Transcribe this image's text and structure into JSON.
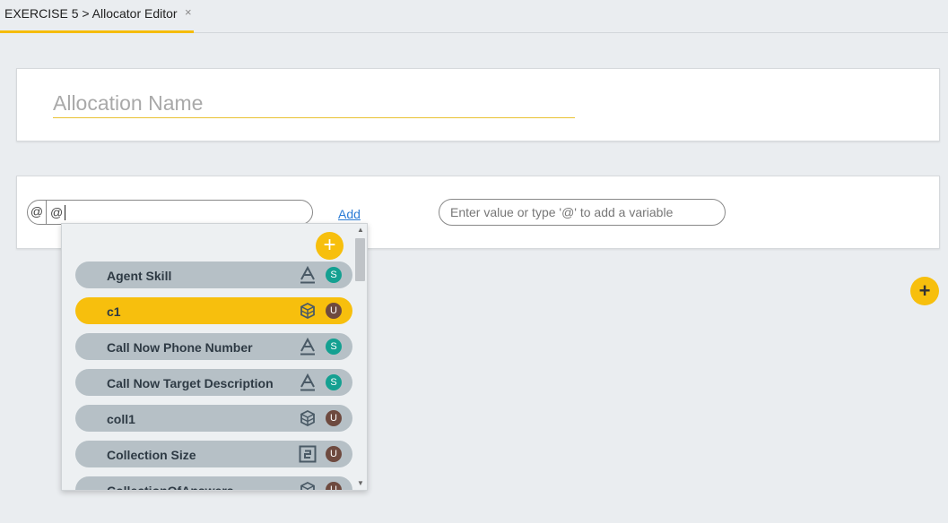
{
  "tab": {
    "label": "EXERCISE 5 > Allocator Editor",
    "close": "×"
  },
  "allocation": {
    "name_placeholder": "Allocation Name"
  },
  "rule": {
    "at_symbol": "@",
    "variable_value": "@",
    "add_label": "Add",
    "value_placeholder": "Enter value or type '@' to add a variable"
  },
  "fab_label": "+",
  "dropdown": {
    "add_label": "+",
    "items": [
      {
        "label": "Agent Skill",
        "type": "text-type-icon",
        "scope": "S"
      },
      {
        "label": "c1",
        "type": "collection-type-icon",
        "scope": "U",
        "selected": true
      },
      {
        "label": "Call Now Phone Number",
        "type": "text-type-icon",
        "scope": "S"
      },
      {
        "label": "Call Now Target Description",
        "type": "text-type-icon",
        "scope": "S"
      },
      {
        "label": "coll1",
        "type": "collection-type-icon",
        "scope": "U"
      },
      {
        "label": "Collection Size",
        "type": "number-type-icon",
        "scope": "U"
      },
      {
        "label": "CollectionOfAnswers",
        "type": "collection-type-icon",
        "scope": "U"
      }
    ]
  },
  "colors": {
    "accent": "#f7bf0d",
    "item_bg": "#b6c0c6",
    "scope_system": "#14a091",
    "scope_user": "#6e4a3f"
  }
}
